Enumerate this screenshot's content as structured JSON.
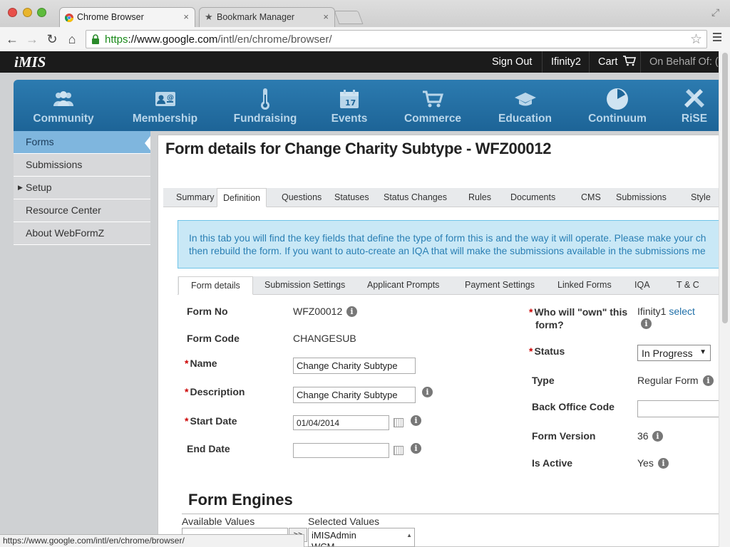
{
  "browser": {
    "tabs": [
      {
        "label": "Chrome Browser",
        "close": "×",
        "active": true
      },
      {
        "label": "Bookmark Manager",
        "close": "×",
        "active": false
      }
    ],
    "url_scheme": "https",
    "url_host": "://www.google.com",
    "url_path": "/intl/en/chrome/browser/",
    "status_url": "https://www.google.com/intl/en/chrome/browser/"
  },
  "imis": {
    "logo": "iMIS",
    "sign_out": "Sign Out",
    "user": "Ifinity2",
    "cart": "Cart",
    "on_behalf": "On Behalf Of: (s"
  },
  "meganav": [
    {
      "label": "Community",
      "icon": "community-icon"
    },
    {
      "label": "Membership",
      "icon": "membership-icon"
    },
    {
      "label": "Fundraising",
      "icon": "thermometer-icon"
    },
    {
      "label": "Events",
      "icon": "calendar-icon"
    },
    {
      "label": "Commerce",
      "icon": "shopping-cart-icon"
    },
    {
      "label": "Education",
      "icon": "graduation-cap-icon"
    },
    {
      "label": "Continuum",
      "icon": "pie-clock-icon"
    },
    {
      "label": "RiSE",
      "icon": "tools-icon"
    }
  ],
  "leftmenu": [
    {
      "label": "Forms",
      "selected": true
    },
    {
      "label": "Submissions"
    },
    {
      "label": "Setup",
      "expandable": true
    },
    {
      "label": "Resource Center"
    },
    {
      "label": "About WebFormZ"
    }
  ],
  "page_title": "Form details for Change Charity Subtype - WFZ00012",
  "tabs": [
    "Summary",
    "Definition",
    "Questions",
    "Statuses",
    "Status Changes",
    "Rules",
    "Documents",
    "CMS",
    "Submissions",
    "Style"
  ],
  "active_tab": "Definition",
  "info_text_1": "In this tab you will find the key fields that define the type of form this is and the way it will operate. Please make your ch",
  "info_text_2": "then rebuild the form. If you want to auto-create an IQA that will make the submissions available in the submissions me",
  "subtabs": [
    "Form details",
    "Submission Settings",
    "Applicant Prompts",
    "Payment Settings",
    "Linked Forms",
    "IQA",
    "T & C"
  ],
  "active_subtab": "Form details",
  "form": {
    "form_no_label": "Form No",
    "form_no": "WFZ00012",
    "form_code_label": "Form Code",
    "form_code": "CHANGESUB",
    "name_label": "Name",
    "name_value": "Change Charity Subtype",
    "description_label": "Description",
    "description_value": "Change Charity Subtype",
    "start_date_label": "Start Date",
    "start_date": "01/04/2014",
    "end_date_label": "End Date",
    "end_date": "",
    "owner_label_1": "Who will \"own\" this",
    "owner_label_2": "form?",
    "owner_value": "Ifinity1",
    "owner_select": "select",
    "status_label": "Status",
    "status_value": "In Progress",
    "type_label": "Type",
    "type_value": "Regular Form",
    "back_office_label": "Back Office Code",
    "back_office_value": "",
    "version_label": "Form Version",
    "version_value": "36",
    "active_label": "Is Active",
    "active_value": "Yes",
    "info_glyph": "i",
    "required_mark": "*"
  },
  "engines": {
    "title": "Form Engines",
    "available_label": "Available Values",
    "selected_label": "Selected Values",
    "move_button": ">>",
    "selected_values": [
      "iMISAdmin",
      "WCM"
    ]
  }
}
